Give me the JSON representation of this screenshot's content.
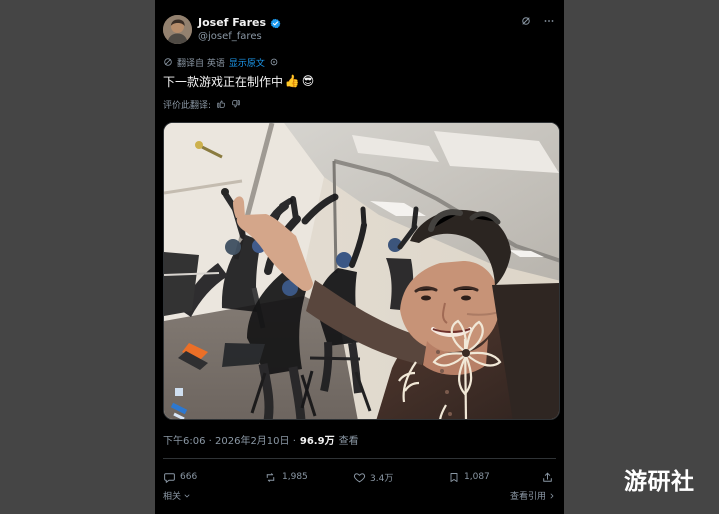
{
  "post": {
    "author_name": "Josef Fares",
    "author_handle": "@josef_fares",
    "translation_prefix": "翻译自 英语",
    "show_original": "显示原文",
    "text": "下一款游戏正在制作中",
    "emoji_1": "👍",
    "emoji_2": "😎",
    "rate_translation": "评价此翻译:",
    "timestamp": "下午6:06 · 2026年2月10日 ·",
    "views_count": "96.9万",
    "views_label": "查看"
  },
  "actions": {
    "reply_count": "666",
    "repost_count": "1,985",
    "like_count": "3.4万",
    "bookmark_count": "1,087"
  },
  "footer": {
    "related": "相关",
    "view_quotes": "查看引用"
  },
  "watermark": {
    "text": "游研社"
  },
  "colors": {
    "page_background": "#454545",
    "post_background": "#000000",
    "accent": "#1d9bf0",
    "muted_text": "#8b98a5"
  },
  "icons": {
    "verified": "verified-badge-icon",
    "grok": "grok-icon",
    "more": "more-icon",
    "translate": "translate-icon",
    "like_translation": "thumbs-up-icon",
    "dislike_translation": "thumbs-down-icon",
    "reply": "reply-icon",
    "repost": "repost-icon",
    "like": "heart-icon",
    "bookmark": "bookmark-icon",
    "share": "share-icon"
  }
}
